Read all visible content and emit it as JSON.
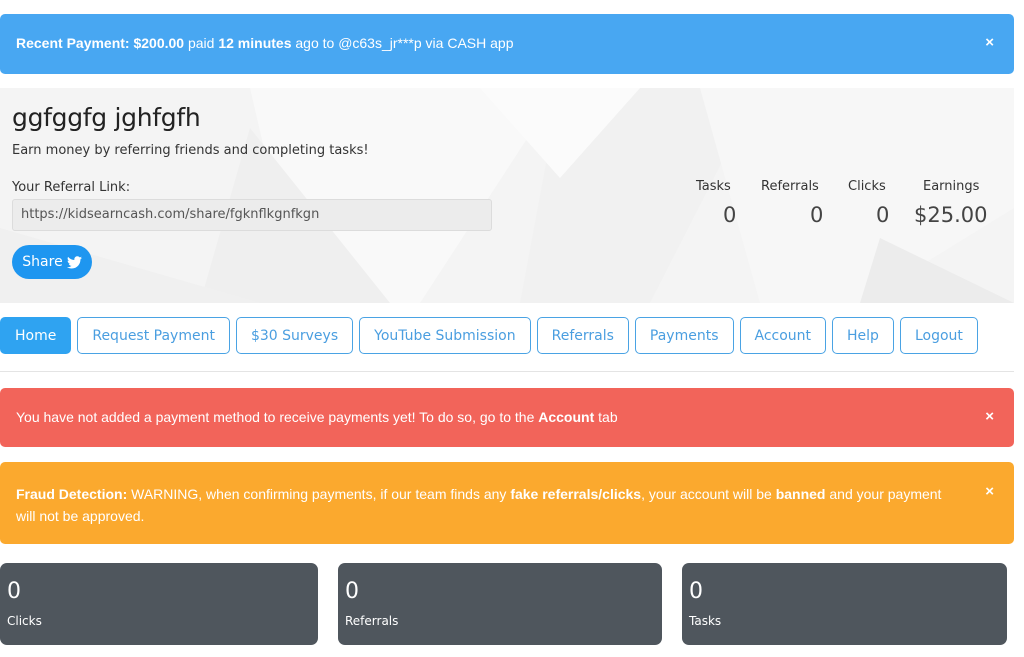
{
  "recent_payment": {
    "label": "Recent Payment:",
    "amount": "$200.00",
    "text_paid": "paid",
    "time": "12 minutes",
    "text_rest": "ago to @c63s_jr***p via CASH app",
    "close": "×",
    "color": "#48a7f2"
  },
  "profile": {
    "name": "ggfggfg jghfgfh",
    "tagline": "Earn money by referring friends and completing tasks!",
    "referral_label": "Your Referral Link:",
    "referral_link": "https://kidsearncash.com/share/fgknflkgnfkgn",
    "share_label": "Share",
    "share_icon": "twitter-icon"
  },
  "summary": {
    "tasks_label": "Tasks",
    "tasks_value": "0",
    "referrals_label": "Referrals",
    "referrals_value": "0",
    "clicks_label": "Clicks",
    "clicks_value": "0",
    "earnings_label": "Earnings",
    "earnings_value": "$25.00"
  },
  "nav": {
    "items": [
      {
        "label": "Home",
        "active": true
      },
      {
        "label": "Request Payment"
      },
      {
        "label": "$30 Surveys"
      },
      {
        "label": "YouTube Submission"
      },
      {
        "label": "Referrals"
      },
      {
        "label": "Payments"
      },
      {
        "label": "Account"
      },
      {
        "label": "Help"
      },
      {
        "label": "Logout"
      }
    ]
  },
  "payment_alert": {
    "text": "You have not added a payment method to receive payments yet! To do so, go to the",
    "bold": "Account",
    "tail": "tab",
    "close": "×",
    "color": "#f2645a"
  },
  "fraud_alert": {
    "label": "Fraud Detection:",
    "text1": "WARNING, when confirming payments, if our team finds any",
    "bold1": "fake referrals/clicks",
    "text2": ", your account will be",
    "bold2": "banned",
    "text3": "and your payment will not be approved.",
    "close": "×",
    "color": "#fba92e"
  },
  "cards": [
    {
      "value": "0",
      "label": "Clicks"
    },
    {
      "value": "0",
      "label": "Referrals"
    },
    {
      "value": "0",
      "label": "Tasks"
    }
  ]
}
